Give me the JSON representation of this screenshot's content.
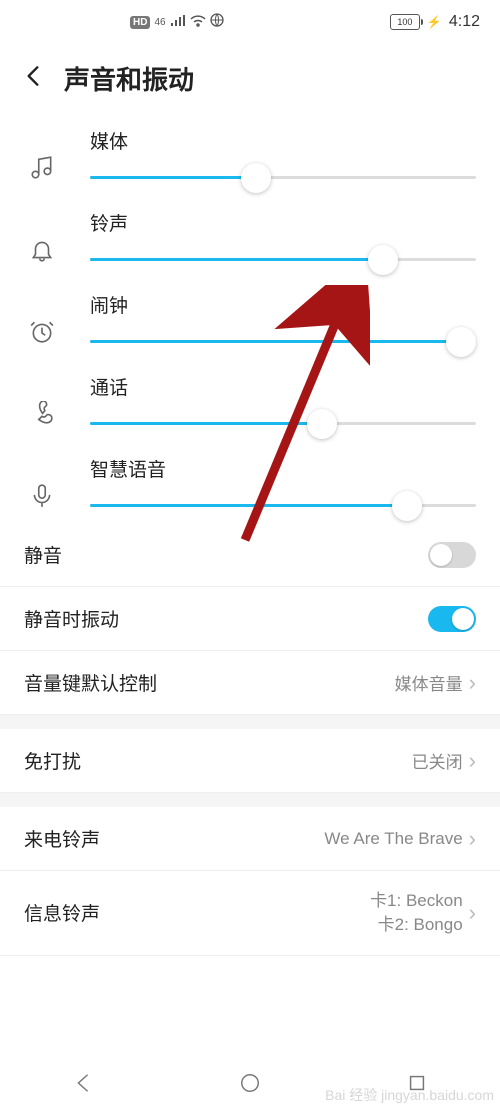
{
  "status": {
    "hd": "HD",
    "net": "46",
    "battery": "100",
    "time": "4:12"
  },
  "header": {
    "title": "声音和振动"
  },
  "sliders": [
    {
      "label": "媒体",
      "percent": 43
    },
    {
      "label": "铃声",
      "percent": 76
    },
    {
      "label": "闹钟",
      "percent": 96
    },
    {
      "label": "通话",
      "percent": 60
    },
    {
      "label": "智慧语音",
      "percent": 82
    }
  ],
  "rows": {
    "mute": {
      "label": "静音",
      "on": false
    },
    "vibrate_on_mute": {
      "label": "静音时振动",
      "on": true
    },
    "volume_key": {
      "label": "音量键默认控制",
      "value": "媒体音量"
    },
    "dnd": {
      "label": "免打扰",
      "value": "已关闭"
    },
    "ringtone": {
      "label": "来电铃声",
      "value": "We Are The Brave"
    },
    "message_tone": {
      "label": "信息铃声",
      "value1": "卡1: Beckon",
      "value2": "卡2: Bongo"
    }
  },
  "watermark": "Bai 经验 jingyan.baidu.com"
}
